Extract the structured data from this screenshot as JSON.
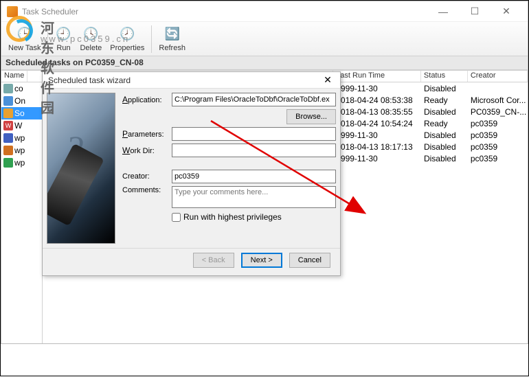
{
  "window": {
    "title": "Task Scheduler"
  },
  "toolbar": {
    "new_task": "New Task",
    "run": "Run",
    "delete": "Delete",
    "properties": "Properties",
    "refresh": "Refresh"
  },
  "sched_header": "Scheduled tasks on PC0359_CN-08",
  "columns": {
    "name": "Name",
    "last_run": "Last Run Time",
    "status": "Status",
    "creator": "Creator"
  },
  "left_tasks": [
    {
      "icon": "calc",
      "label": "co"
    },
    {
      "icon": "one",
      "label": "On"
    },
    {
      "icon": "sys",
      "label": "So",
      "selected": true
    },
    {
      "icon": "w",
      "label": "W"
    },
    {
      "icon": "wp1",
      "label": "wp"
    },
    {
      "icon": "wp2",
      "label": "wp"
    },
    {
      "icon": "wp3",
      "label": "wp"
    }
  ],
  "grid_rows": [
    {
      "last_run": "1999-11-30",
      "status": "Disabled",
      "creator": ""
    },
    {
      "last_run": "2018-04-24 08:53:38",
      "status": "Ready",
      "creator": "Microsoft Cor..."
    },
    {
      "last_run": "2018-04-13 08:35:55",
      "status": "Disabled",
      "creator": "PC0359_CN-..."
    },
    {
      "last_run": "2018-04-24 10:54:24",
      "status": "Ready",
      "creator": "pc0359"
    },
    {
      "last_run": "1999-11-30",
      "status": "Disabled",
      "creator": "pc0359"
    },
    {
      "last_run": "2018-04-13 18:17:13",
      "status": "Disabled",
      "creator": "pc0359"
    },
    {
      "last_run": "1999-11-30",
      "status": "Disabled",
      "creator": "pc0359"
    }
  ],
  "dialog": {
    "title": "Scheduled task wizard",
    "labels": {
      "application": "Application:",
      "parameters": "Parameters:",
      "workdir": "Work Dir:",
      "creator": "Creator:",
      "comments": "Comments:"
    },
    "values": {
      "application": "C:\\Program Files\\OracleToDbf\\OracleToDbf.ex",
      "parameters": "",
      "workdir": "",
      "creator": "pc0359",
      "comments_placeholder": "Type your comments here..."
    },
    "browse": "Browse...",
    "run_highest": "Run with highest privileges",
    "back": "< Back",
    "next": "Next >",
    "cancel": "Cancel"
  },
  "watermark": {
    "brand": "河东软件园",
    "url": "www.pc0359.cn"
  }
}
